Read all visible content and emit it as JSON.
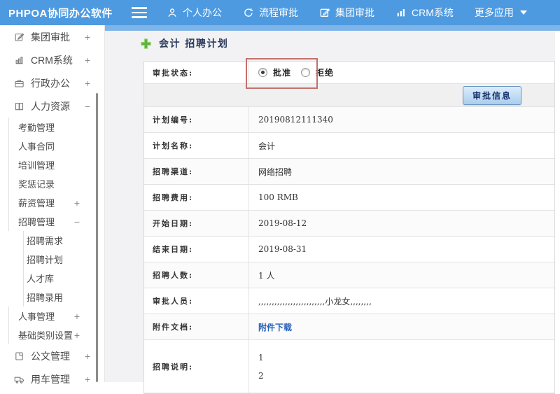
{
  "topbar": {
    "logo": "PHPOA协同办公软件",
    "nav": [
      {
        "label": "个人办公",
        "icon": "user-icon"
      },
      {
        "label": "流程审批",
        "icon": "process-arrow-icon"
      },
      {
        "label": "集团审批",
        "icon": "edit-icon"
      },
      {
        "label": "CRM系统",
        "icon": "bar-chart-icon"
      },
      {
        "label": "更多应用",
        "icon": "caret-down-icon"
      }
    ]
  },
  "sidebar": {
    "items": [
      {
        "label": "集团审批",
        "icon": "edit-square-icon",
        "level": 1,
        "marker": "+"
      },
      {
        "label": "CRM系统",
        "icon": "bar-chart-icon",
        "level": 1,
        "marker": "+"
      },
      {
        "label": "行政办公",
        "icon": "briefcase-icon",
        "level": 1,
        "marker": "+"
      },
      {
        "label": "人力资源",
        "icon": "book-icon",
        "level": 1,
        "marker": "−"
      },
      {
        "label": "考勤管理",
        "level": 2,
        "marker": ""
      },
      {
        "label": "人事合同",
        "level": 2,
        "marker": ""
      },
      {
        "label": "培训管理",
        "level": 2,
        "marker": ""
      },
      {
        "label": "奖惩记录",
        "level": 2,
        "marker": ""
      },
      {
        "label": "薪资管理",
        "level": 2,
        "marker": "+"
      },
      {
        "label": "招聘管理",
        "level": 2,
        "marker": "−"
      },
      {
        "label": "招聘需求",
        "level": 3,
        "marker": ""
      },
      {
        "label": "招聘计划",
        "level": 3,
        "marker": ""
      },
      {
        "label": "人才库",
        "level": 3,
        "marker": ""
      },
      {
        "label": "招聘录用",
        "level": 3,
        "marker": ""
      },
      {
        "label": "人事管理",
        "level": 2,
        "marker": "+"
      },
      {
        "label": "基础类别设置",
        "level": 2,
        "marker": "+"
      },
      {
        "label": "公文管理",
        "icon": "document-icon",
        "level": 1,
        "marker": "+"
      },
      {
        "label": "用车管理",
        "icon": "truck-icon",
        "level": 1,
        "marker": "+"
      }
    ]
  },
  "main": {
    "title": "会计 招聘计划",
    "approval_row": {
      "label": "审批状态:",
      "options": [
        {
          "label": "批准",
          "selected": true
        },
        {
          "label": "拒绝",
          "selected": false
        }
      ]
    },
    "approve_button": "审批信息",
    "fields": [
      {
        "label": "计划编号:",
        "value": "20190812111340",
        "type": "text"
      },
      {
        "label": "计划名称:",
        "value": "会计",
        "type": "text"
      },
      {
        "label": "招聘渠道:",
        "value": "网络招聘",
        "type": "text"
      },
      {
        "label": "招聘费用:",
        "value": "100 RMB",
        "type": "text"
      },
      {
        "label": "开始日期:",
        "value": "2019-08-12",
        "type": "text"
      },
      {
        "label": "结束日期:",
        "value": "2019-08-31",
        "type": "text"
      },
      {
        "label": "招聘人数:",
        "value": "1 人",
        "type": "text"
      },
      {
        "label": "审批人员:",
        "value": ",,,,,,,,,,,,,,,,,,,,,,,,,小龙女,,,,,,,,",
        "type": "text"
      },
      {
        "label": "附件文档:",
        "value": "附件下载",
        "type": "link"
      },
      {
        "label": "招聘说明:",
        "lines": [
          "1",
          "2"
        ],
        "type": "multiline"
      }
    ]
  },
  "colors": {
    "topbar_blue": "#4E9AE0",
    "strip_blue": "#7FB4E9",
    "annotation_red": "#C4706B",
    "link_blue": "#2A62B8",
    "title_navy": "#2A3A5C",
    "plus_green": "#5CB637"
  }
}
